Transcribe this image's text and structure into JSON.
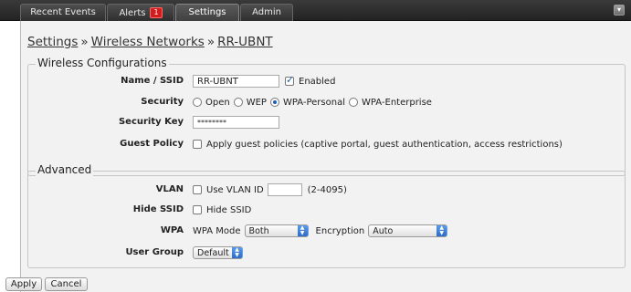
{
  "tabs": [
    {
      "label": "Recent Events"
    },
    {
      "label": "Alerts",
      "badge": "1"
    },
    {
      "label": "Settings"
    },
    {
      "label": "Admin"
    }
  ],
  "breadcrumb": {
    "settings": "Settings",
    "sep1": "»",
    "wireless": "Wireless Networks",
    "sep2": "»",
    "current": "RR-UBNT"
  },
  "wireless_config": {
    "legend": "Wireless Configurations",
    "name_label": "Name / SSID",
    "name_value": "RR-UBNT",
    "enabled_label": "Enabled",
    "enabled_checked": true,
    "security_label": "Security",
    "security_options": [
      "Open",
      "WEP",
      "WPA-Personal",
      "WPA-Enterprise"
    ],
    "security_selected": "WPA-Personal",
    "security_key_label": "Security Key",
    "security_key_value": "********",
    "guest_label": "Guest Policy",
    "guest_text": "Apply guest policies (captive portal, guest authentication, access restrictions)",
    "guest_checked": false
  },
  "advanced": {
    "legend": "Advanced",
    "vlan_label": "VLAN",
    "vlan_checkbox_text": "Use VLAN ID",
    "vlan_value": "",
    "vlan_range": "(2-4095)",
    "hide_ssid_label": "Hide SSID",
    "hide_ssid_text": "Hide SSID",
    "wpa_label": "WPA",
    "wpa_mode_label": "WPA Mode",
    "wpa_mode_value": "Both",
    "encryption_label": "Encryption",
    "encryption_value": "Auto",
    "user_group_label": "User Group",
    "user_group_value": "Default"
  },
  "buttons": {
    "apply": "Apply",
    "cancel": "Cancel"
  }
}
